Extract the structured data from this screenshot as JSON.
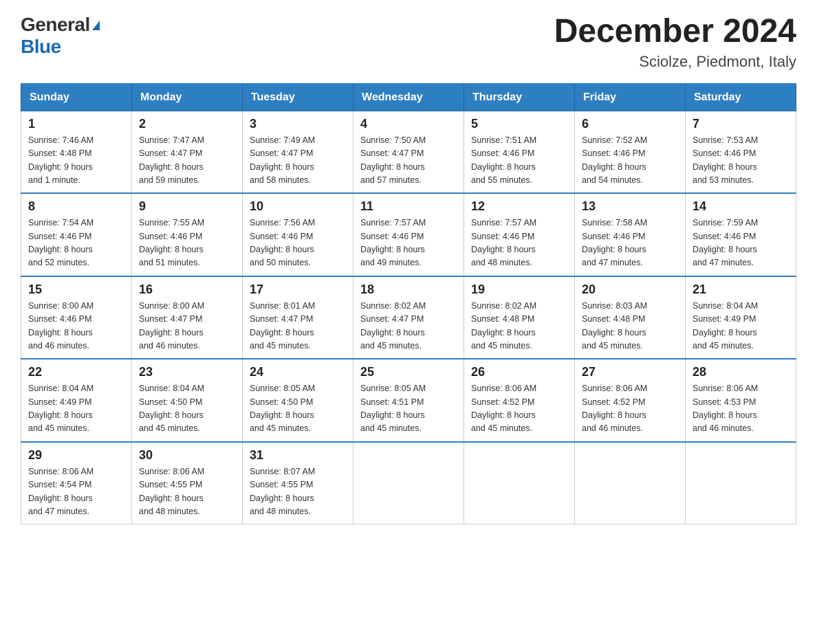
{
  "header": {
    "logo_general": "General",
    "logo_blue": "Blue",
    "month_title": "December 2024",
    "location": "Sciolze, Piedmont, Italy"
  },
  "days_of_week": [
    "Sunday",
    "Monday",
    "Tuesday",
    "Wednesday",
    "Thursday",
    "Friday",
    "Saturday"
  ],
  "weeks": [
    [
      {
        "day": "1",
        "sunrise": "7:46 AM",
        "sunset": "4:48 PM",
        "daylight": "9 hours and 1 minute."
      },
      {
        "day": "2",
        "sunrise": "7:47 AM",
        "sunset": "4:47 PM",
        "daylight": "8 hours and 59 minutes."
      },
      {
        "day": "3",
        "sunrise": "7:49 AM",
        "sunset": "4:47 PM",
        "daylight": "8 hours and 58 minutes."
      },
      {
        "day": "4",
        "sunrise": "7:50 AM",
        "sunset": "4:47 PM",
        "daylight": "8 hours and 57 minutes."
      },
      {
        "day": "5",
        "sunrise": "7:51 AM",
        "sunset": "4:46 PM",
        "daylight": "8 hours and 55 minutes."
      },
      {
        "day": "6",
        "sunrise": "7:52 AM",
        "sunset": "4:46 PM",
        "daylight": "8 hours and 54 minutes."
      },
      {
        "day": "7",
        "sunrise": "7:53 AM",
        "sunset": "4:46 PM",
        "daylight": "8 hours and 53 minutes."
      }
    ],
    [
      {
        "day": "8",
        "sunrise": "7:54 AM",
        "sunset": "4:46 PM",
        "daylight": "8 hours and 52 minutes."
      },
      {
        "day": "9",
        "sunrise": "7:55 AM",
        "sunset": "4:46 PM",
        "daylight": "8 hours and 51 minutes."
      },
      {
        "day": "10",
        "sunrise": "7:56 AM",
        "sunset": "4:46 PM",
        "daylight": "8 hours and 50 minutes."
      },
      {
        "day": "11",
        "sunrise": "7:57 AM",
        "sunset": "4:46 PM",
        "daylight": "8 hours and 49 minutes."
      },
      {
        "day": "12",
        "sunrise": "7:57 AM",
        "sunset": "4:46 PM",
        "daylight": "8 hours and 48 minutes."
      },
      {
        "day": "13",
        "sunrise": "7:58 AM",
        "sunset": "4:46 PM",
        "daylight": "8 hours and 47 minutes."
      },
      {
        "day": "14",
        "sunrise": "7:59 AM",
        "sunset": "4:46 PM",
        "daylight": "8 hours and 47 minutes."
      }
    ],
    [
      {
        "day": "15",
        "sunrise": "8:00 AM",
        "sunset": "4:46 PM",
        "daylight": "8 hours and 46 minutes."
      },
      {
        "day": "16",
        "sunrise": "8:00 AM",
        "sunset": "4:47 PM",
        "daylight": "8 hours and 46 minutes."
      },
      {
        "day": "17",
        "sunrise": "8:01 AM",
        "sunset": "4:47 PM",
        "daylight": "8 hours and 45 minutes."
      },
      {
        "day": "18",
        "sunrise": "8:02 AM",
        "sunset": "4:47 PM",
        "daylight": "8 hours and 45 minutes."
      },
      {
        "day": "19",
        "sunrise": "8:02 AM",
        "sunset": "4:48 PM",
        "daylight": "8 hours and 45 minutes."
      },
      {
        "day": "20",
        "sunrise": "8:03 AM",
        "sunset": "4:48 PM",
        "daylight": "8 hours and 45 minutes."
      },
      {
        "day": "21",
        "sunrise": "8:04 AM",
        "sunset": "4:49 PM",
        "daylight": "8 hours and 45 minutes."
      }
    ],
    [
      {
        "day": "22",
        "sunrise": "8:04 AM",
        "sunset": "4:49 PM",
        "daylight": "8 hours and 45 minutes."
      },
      {
        "day": "23",
        "sunrise": "8:04 AM",
        "sunset": "4:50 PM",
        "daylight": "8 hours and 45 minutes."
      },
      {
        "day": "24",
        "sunrise": "8:05 AM",
        "sunset": "4:50 PM",
        "daylight": "8 hours and 45 minutes."
      },
      {
        "day": "25",
        "sunrise": "8:05 AM",
        "sunset": "4:51 PM",
        "daylight": "8 hours and 45 minutes."
      },
      {
        "day": "26",
        "sunrise": "8:06 AM",
        "sunset": "4:52 PM",
        "daylight": "8 hours and 45 minutes."
      },
      {
        "day": "27",
        "sunrise": "8:06 AM",
        "sunset": "4:52 PM",
        "daylight": "8 hours and 46 minutes."
      },
      {
        "day": "28",
        "sunrise": "8:06 AM",
        "sunset": "4:53 PM",
        "daylight": "8 hours and 46 minutes."
      }
    ],
    [
      {
        "day": "29",
        "sunrise": "8:06 AM",
        "sunset": "4:54 PM",
        "daylight": "8 hours and 47 minutes."
      },
      {
        "day": "30",
        "sunrise": "8:06 AM",
        "sunset": "4:55 PM",
        "daylight": "8 hours and 48 minutes."
      },
      {
        "day": "31",
        "sunrise": "8:07 AM",
        "sunset": "4:55 PM",
        "daylight": "8 hours and 48 minutes."
      },
      null,
      null,
      null,
      null
    ]
  ],
  "labels": {
    "sunrise": "Sunrise:",
    "sunset": "Sunset:",
    "daylight": "Daylight:"
  }
}
